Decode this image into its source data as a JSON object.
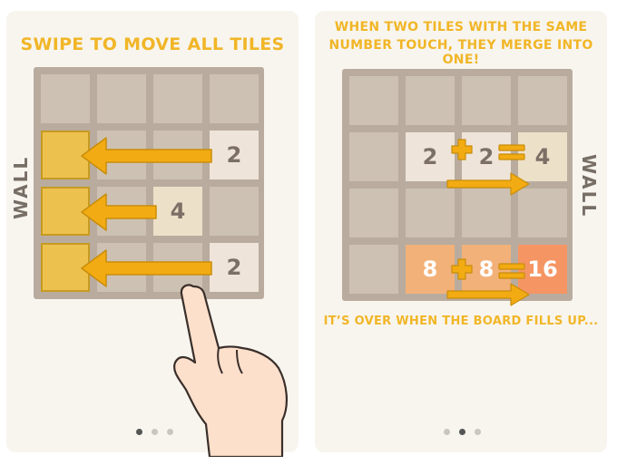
{
  "colors": {
    "accent": "#f1b627",
    "arrow": "#f2ab12",
    "board": "#b9ac9f",
    "cell": "#cdc1b3"
  },
  "left_panel": {
    "title": "SWIPE TO MOVE ALL TILES",
    "wall_label": "WALL",
    "tiles": {
      "row2": "2",
      "row3": "4",
      "row4": "2"
    },
    "pager": {
      "pages": 3,
      "active_index": 0
    }
  },
  "right_panel": {
    "title_line1": "WHEN TWO TILES WITH THE SAME",
    "title_line2": "NUMBER TOUCH, THEY MERGE INTO ONE!",
    "wall_label": "WALL",
    "merge_rows": [
      {
        "a": "2",
        "b": "2",
        "result": "4"
      },
      {
        "a": "8",
        "b": "8",
        "result": "16"
      }
    ],
    "footer": "IT’S OVER WHEN THE BOARD FILLS UP...",
    "pager": {
      "pages": 3,
      "active_index": 1
    }
  }
}
